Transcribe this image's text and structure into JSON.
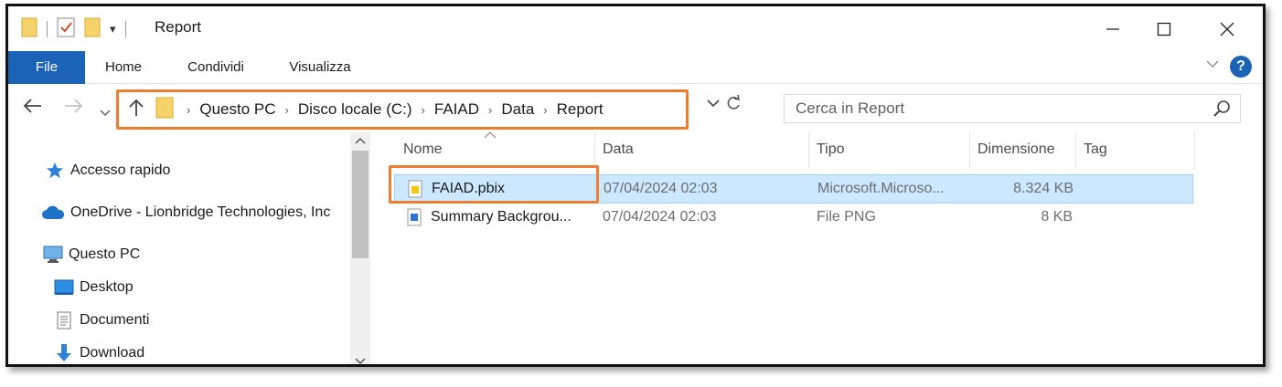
{
  "window": {
    "title": "Report",
    "minimize_label": "—",
    "maximize_label": "☐",
    "close_label": "✕"
  },
  "ribbon": {
    "tabs": [
      {
        "label": "File"
      },
      {
        "label": "Home"
      },
      {
        "label": "Condividi"
      },
      {
        "label": "Visualizza"
      }
    ]
  },
  "breadcrumb": [
    "Questo PC",
    "Disco locale (C:)",
    "FAIAD",
    "Data",
    "Report"
  ],
  "search": {
    "placeholder": "Cerca in Report"
  },
  "navpane": {
    "items": [
      {
        "label": "Accesso rapido",
        "icon": "star-icon"
      },
      {
        "label": "OneDrive - Lionbridge Technologies, Inc",
        "icon": "cloud-icon"
      },
      {
        "label": "Questo PC",
        "icon": "computer-icon"
      },
      {
        "label": "Desktop",
        "icon": "desktop-icon"
      },
      {
        "label": "Documenti",
        "icon": "document-icon"
      },
      {
        "label": "Download",
        "icon": "download-icon"
      }
    ]
  },
  "columns": [
    "Nome",
    "Data",
    "Tipo",
    "Dimensione",
    "Tag"
  ],
  "files": [
    {
      "name": "FAIAD.pbix",
      "date": "07/04/2024 02:03",
      "type": "Microsoft.Microso...",
      "size": "8.324 KB",
      "tag": "",
      "selected": true,
      "icon": "pbix-file-icon"
    },
    {
      "name": "Summary Backgrou...",
      "date": "07/04/2024 02:03",
      "type": "File PNG",
      "size": "8 KB",
      "tag": "",
      "selected": false,
      "icon": "png-file-icon"
    }
  ],
  "colors": {
    "accent": "#1a63b6",
    "highlight": "#ed7d31",
    "selection": "#cce8ff"
  }
}
